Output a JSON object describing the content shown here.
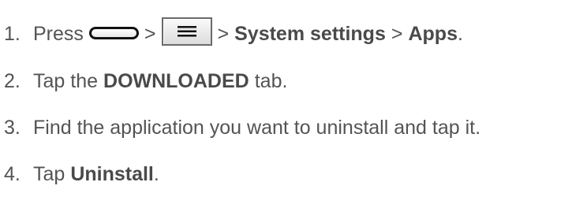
{
  "steps": [
    {
      "number": "1.",
      "press_text": "Press",
      "separator": ">",
      "system_settings": "System settings",
      "apps": "Apps",
      "end": ".",
      "icons": [
        "home-key-icon",
        "menu-key-icon"
      ]
    },
    {
      "number": "2.",
      "before": "Tap the",
      "bold": "DOWNLOADED",
      "after": "tab."
    },
    {
      "number": "3.",
      "text": "Find the application you want to uninstall and tap it."
    },
    {
      "number": "4.",
      "before": "Tap",
      "bold": "Uninstall",
      "after": "."
    }
  ],
  "colors": {
    "text": "#545454",
    "background": "#ffffff"
  }
}
